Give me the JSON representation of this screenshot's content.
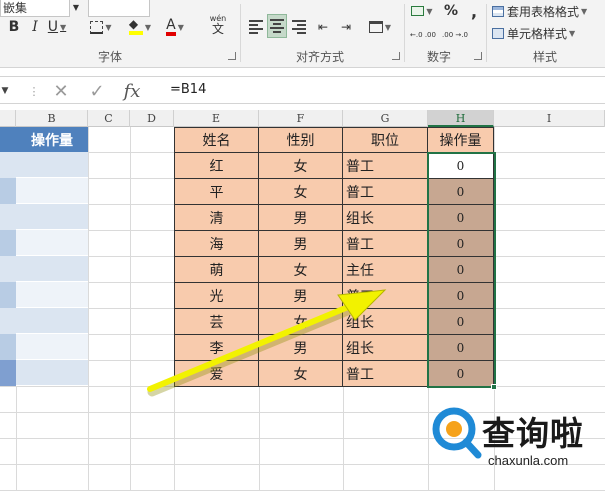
{
  "ribbon": {
    "font_name_partial": "嵌集",
    "bold": "B",
    "italic": "I",
    "underline": "U",
    "font_color_letter": "A",
    "wen_top": "wén",
    "wen_char": "文",
    "percent": "%",
    "comma": ",",
    "decimal_up": "←.0 .00",
    "decimal_down": ".00 →.0",
    "cond_format_label": "套用表格格式",
    "cell_style_label": "单元格样式",
    "groups": {
      "font": "字体",
      "alignment": "对齐方式",
      "number": "数字",
      "styles": "样式"
    }
  },
  "formula_bar": {
    "cancel": "✕",
    "enter": "✓",
    "fx": "fx",
    "formula": "=B14"
  },
  "columns": [
    "B",
    "C",
    "D",
    "E",
    "F",
    "G",
    "H",
    "I"
  ],
  "active_column": "H",
  "left_table": {
    "header": "操作量"
  },
  "table": {
    "headers": [
      "姓名",
      "性别",
      "职位",
      "操作量"
    ],
    "rows": [
      {
        "name": "红",
        "gender": "女",
        "position": "普工",
        "amount": "0"
      },
      {
        "name": "平",
        "gender": "女",
        "position": "普工",
        "amount": "0"
      },
      {
        "name": "清",
        "gender": "男",
        "position": "组长",
        "amount": "0"
      },
      {
        "name": "海",
        "gender": "男",
        "position": "普工",
        "amount": "0"
      },
      {
        "name": "萌",
        "gender": "女",
        "position": "主任",
        "amount": "0"
      },
      {
        "name": "光",
        "gender": "男",
        "position": "普工",
        "amount": "0"
      },
      {
        "name": "芸",
        "gender": "女",
        "position": "组长",
        "amount": "0"
      },
      {
        "name": "李",
        "gender": "男",
        "position": "组长",
        "amount": "0"
      },
      {
        "name": "爱",
        "gender": "女",
        "position": "普工",
        "amount": "0"
      }
    ]
  },
  "colors": {
    "header_blue": "#4f81bd",
    "table_peach": "#f8cbad",
    "selected_fill": "#c7a791",
    "selection_green": "#217346",
    "arrow_yellow": "#f2f200"
  },
  "watermark": {
    "text": "查询啦",
    "url": "chaxunla.com"
  }
}
